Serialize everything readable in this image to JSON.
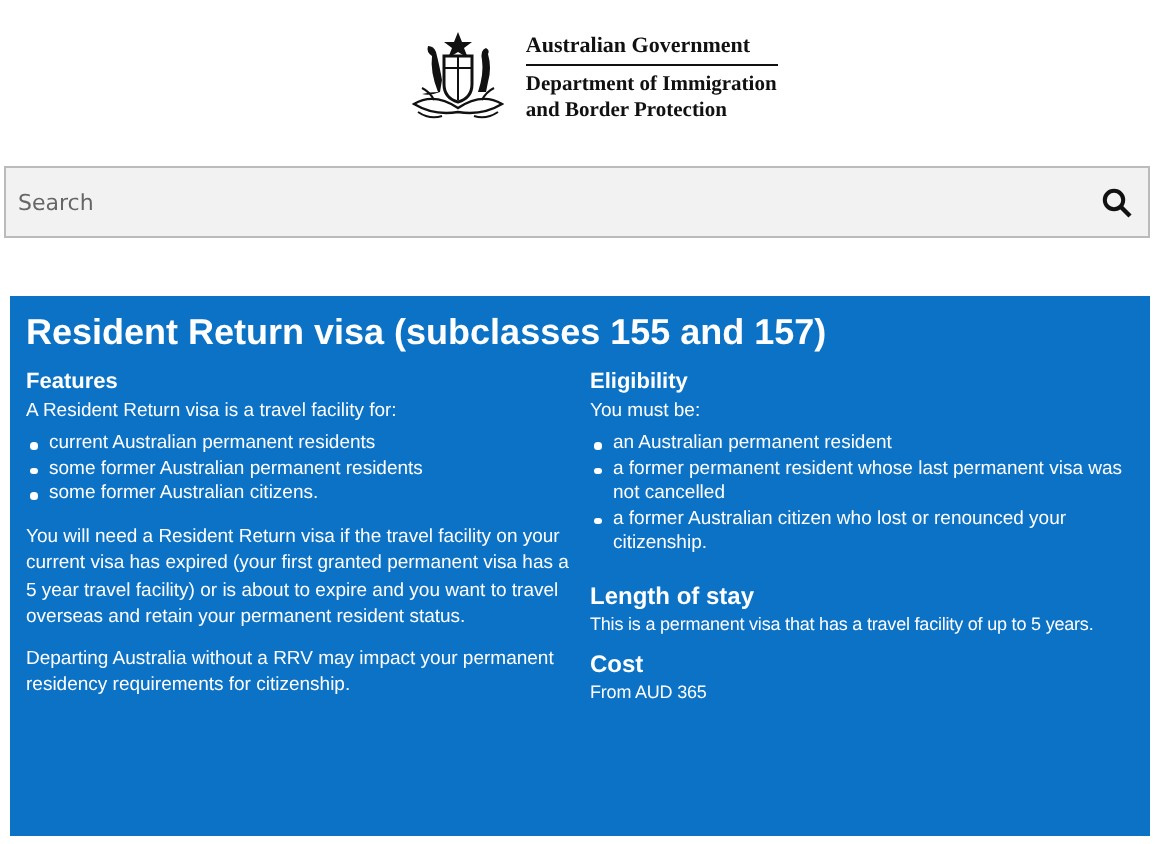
{
  "header": {
    "logo_lines": [
      "Australian Government",
      "Department of Immigration",
      "and Border Protection"
    ]
  },
  "search": {
    "placeholder": "Search"
  },
  "panel": {
    "title": "Resident Return visa (subclasses 155 and 157)",
    "left": {
      "heading": "Features",
      "intro": "A Resident Return visa is a travel facility for:",
      "bullets": [
        "current Australian permanent residents",
        "some former Australian permanent residents",
        "some former Australian citizens."
      ],
      "paragraphs": [
        "You will need a Resident Return visa if the travel facility on your current visa has expired (your first granted permanent visa has a 5 year travel facility) or is about to expire and you want to travel overseas and retain your permanent resident status.",
        "Departing Australia without a RRV may impact your permanent residency requirements for citizenship."
      ]
    },
    "right": {
      "heading": "Eligibility",
      "intro": "You must be:",
      "bullets": [
        "an Australian permanent resident",
        "a former permanent resident whose last permanent visa was not cancelled",
        "a former Australian citizen who lost or renounced your citizenship."
      ],
      "sections": [
        {
          "heading": "Length of stay",
          "text": "This is a permanent visa that has a travel facility of up to 5 years."
        },
        {
          "heading": "Cost",
          "text": "From AUD 365"
        }
      ]
    }
  }
}
